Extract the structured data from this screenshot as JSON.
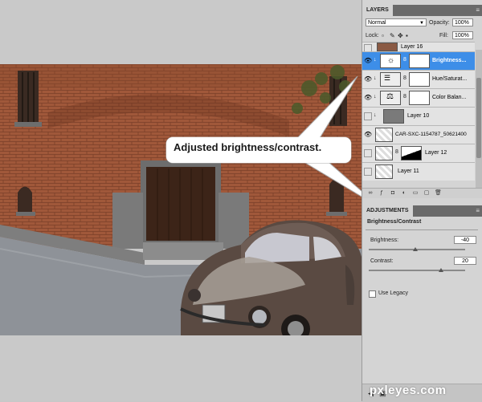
{
  "layers_panel": {
    "tab_label": "LAYERS",
    "blend_mode": "Normal",
    "opacity_label": "Opacity:",
    "opacity_value": "100%",
    "lock_label": "Lock:",
    "fill_label": "Fill:",
    "fill_value": "100%",
    "layers": [
      {
        "name": "Layer 16",
        "visible": false,
        "selected": false
      },
      {
        "name": "Brightness...",
        "visible": true,
        "selected": true
      },
      {
        "name": "Hue/Saturat...",
        "visible": true,
        "selected": false
      },
      {
        "name": "Color Balan...",
        "visible": true,
        "selected": false
      },
      {
        "name": "Layer 10",
        "visible": false,
        "selected": false
      },
      {
        "name": "CAR-SXC-1154787_50621400",
        "visible": true,
        "selected": false
      },
      {
        "name": "Layer 12",
        "visible": false,
        "selected": false
      },
      {
        "name": "Layer 11",
        "visible": false,
        "selected": false
      }
    ]
  },
  "adjustments_panel": {
    "tab_label": "ADJUSTMENTS",
    "title": "Brightness/Contrast",
    "brightness_label": "Brightness:",
    "brightness_value": "-40",
    "contrast_label": "Contrast:",
    "contrast_value": "20",
    "use_legacy_label": "Use Legacy",
    "use_legacy_checked": false
  },
  "canvas": {
    "callout_text": "Adjusted brightness/contrast."
  },
  "watermark": "pxleyes.com",
  "colors": {
    "selection_blue": "#3d8ee8",
    "panel_bg": "#d4d4d4",
    "tab_bar": "#6a6a6a",
    "brick": "#9a5a3c"
  }
}
